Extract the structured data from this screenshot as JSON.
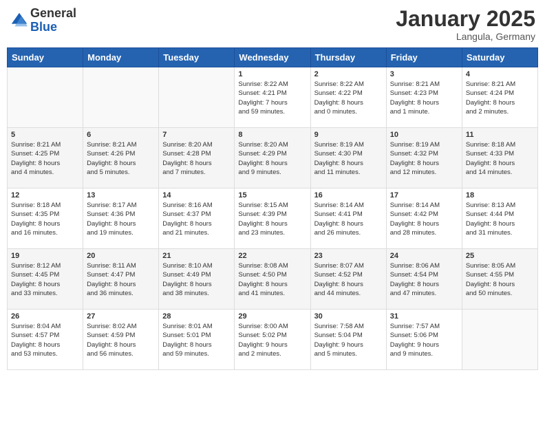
{
  "header": {
    "logo_general": "General",
    "logo_blue": "Blue",
    "month": "January 2025",
    "location": "Langula, Germany"
  },
  "weekdays": [
    "Sunday",
    "Monday",
    "Tuesday",
    "Wednesday",
    "Thursday",
    "Friday",
    "Saturday"
  ],
  "weeks": [
    [
      {
        "day": "",
        "sunrise": "",
        "sunset": "",
        "daylight": ""
      },
      {
        "day": "",
        "sunrise": "",
        "sunset": "",
        "daylight": ""
      },
      {
        "day": "",
        "sunrise": "",
        "sunset": "",
        "daylight": ""
      },
      {
        "day": "1",
        "sunrise": "Sunrise: 8:22 AM",
        "sunset": "Sunset: 4:21 PM",
        "daylight": "Daylight: 7 hours and 59 minutes."
      },
      {
        "day": "2",
        "sunrise": "Sunrise: 8:22 AM",
        "sunset": "Sunset: 4:22 PM",
        "daylight": "Daylight: 8 hours and 0 minutes."
      },
      {
        "day": "3",
        "sunrise": "Sunrise: 8:21 AM",
        "sunset": "Sunset: 4:23 PM",
        "daylight": "Daylight: 8 hours and 1 minute."
      },
      {
        "day": "4",
        "sunrise": "Sunrise: 8:21 AM",
        "sunset": "Sunset: 4:24 PM",
        "daylight": "Daylight: 8 hours and 2 minutes."
      }
    ],
    [
      {
        "day": "5",
        "sunrise": "Sunrise: 8:21 AM",
        "sunset": "Sunset: 4:25 PM",
        "daylight": "Daylight: 8 hours and 4 minutes."
      },
      {
        "day": "6",
        "sunrise": "Sunrise: 8:21 AM",
        "sunset": "Sunset: 4:26 PM",
        "daylight": "Daylight: 8 hours and 5 minutes."
      },
      {
        "day": "7",
        "sunrise": "Sunrise: 8:20 AM",
        "sunset": "Sunset: 4:28 PM",
        "daylight": "Daylight: 8 hours and 7 minutes."
      },
      {
        "day": "8",
        "sunrise": "Sunrise: 8:20 AM",
        "sunset": "Sunset: 4:29 PM",
        "daylight": "Daylight: 8 hours and 9 minutes."
      },
      {
        "day": "9",
        "sunrise": "Sunrise: 8:19 AM",
        "sunset": "Sunset: 4:30 PM",
        "daylight": "Daylight: 8 hours and 11 minutes."
      },
      {
        "day": "10",
        "sunrise": "Sunrise: 8:19 AM",
        "sunset": "Sunset: 4:32 PM",
        "daylight": "Daylight: 8 hours and 12 minutes."
      },
      {
        "day": "11",
        "sunrise": "Sunrise: 8:18 AM",
        "sunset": "Sunset: 4:33 PM",
        "daylight": "Daylight: 8 hours and 14 minutes."
      }
    ],
    [
      {
        "day": "12",
        "sunrise": "Sunrise: 8:18 AM",
        "sunset": "Sunset: 4:35 PM",
        "daylight": "Daylight: 8 hours and 16 minutes."
      },
      {
        "day": "13",
        "sunrise": "Sunrise: 8:17 AM",
        "sunset": "Sunset: 4:36 PM",
        "daylight": "Daylight: 8 hours and 19 minutes."
      },
      {
        "day": "14",
        "sunrise": "Sunrise: 8:16 AM",
        "sunset": "Sunset: 4:37 PM",
        "daylight": "Daylight: 8 hours and 21 minutes."
      },
      {
        "day": "15",
        "sunrise": "Sunrise: 8:15 AM",
        "sunset": "Sunset: 4:39 PM",
        "daylight": "Daylight: 8 hours and 23 minutes."
      },
      {
        "day": "16",
        "sunrise": "Sunrise: 8:14 AM",
        "sunset": "Sunset: 4:41 PM",
        "daylight": "Daylight: 8 hours and 26 minutes."
      },
      {
        "day": "17",
        "sunrise": "Sunrise: 8:14 AM",
        "sunset": "Sunset: 4:42 PM",
        "daylight": "Daylight: 8 hours and 28 minutes."
      },
      {
        "day": "18",
        "sunrise": "Sunrise: 8:13 AM",
        "sunset": "Sunset: 4:44 PM",
        "daylight": "Daylight: 8 hours and 31 minutes."
      }
    ],
    [
      {
        "day": "19",
        "sunrise": "Sunrise: 8:12 AM",
        "sunset": "Sunset: 4:45 PM",
        "daylight": "Daylight: 8 hours and 33 minutes."
      },
      {
        "day": "20",
        "sunrise": "Sunrise: 8:11 AM",
        "sunset": "Sunset: 4:47 PM",
        "daylight": "Daylight: 8 hours and 36 minutes."
      },
      {
        "day": "21",
        "sunrise": "Sunrise: 8:10 AM",
        "sunset": "Sunset: 4:49 PM",
        "daylight": "Daylight: 8 hours and 38 minutes."
      },
      {
        "day": "22",
        "sunrise": "Sunrise: 8:08 AM",
        "sunset": "Sunset: 4:50 PM",
        "daylight": "Daylight: 8 hours and 41 minutes."
      },
      {
        "day": "23",
        "sunrise": "Sunrise: 8:07 AM",
        "sunset": "Sunset: 4:52 PM",
        "daylight": "Daylight: 8 hours and 44 minutes."
      },
      {
        "day": "24",
        "sunrise": "Sunrise: 8:06 AM",
        "sunset": "Sunset: 4:54 PM",
        "daylight": "Daylight: 8 hours and 47 minutes."
      },
      {
        "day": "25",
        "sunrise": "Sunrise: 8:05 AM",
        "sunset": "Sunset: 4:55 PM",
        "daylight": "Daylight: 8 hours and 50 minutes."
      }
    ],
    [
      {
        "day": "26",
        "sunrise": "Sunrise: 8:04 AM",
        "sunset": "Sunset: 4:57 PM",
        "daylight": "Daylight: 8 hours and 53 minutes."
      },
      {
        "day": "27",
        "sunrise": "Sunrise: 8:02 AM",
        "sunset": "Sunset: 4:59 PM",
        "daylight": "Daylight: 8 hours and 56 minutes."
      },
      {
        "day": "28",
        "sunrise": "Sunrise: 8:01 AM",
        "sunset": "Sunset: 5:01 PM",
        "daylight": "Daylight: 8 hours and 59 minutes."
      },
      {
        "day": "29",
        "sunrise": "Sunrise: 8:00 AM",
        "sunset": "Sunset: 5:02 PM",
        "daylight": "Daylight: 9 hours and 2 minutes."
      },
      {
        "day": "30",
        "sunrise": "Sunrise: 7:58 AM",
        "sunset": "Sunset: 5:04 PM",
        "daylight": "Daylight: 9 hours and 5 minutes."
      },
      {
        "day": "31",
        "sunrise": "Sunrise: 7:57 AM",
        "sunset": "Sunset: 5:06 PM",
        "daylight": "Daylight: 9 hours and 9 minutes."
      },
      {
        "day": "",
        "sunrise": "",
        "sunset": "",
        "daylight": ""
      }
    ]
  ]
}
